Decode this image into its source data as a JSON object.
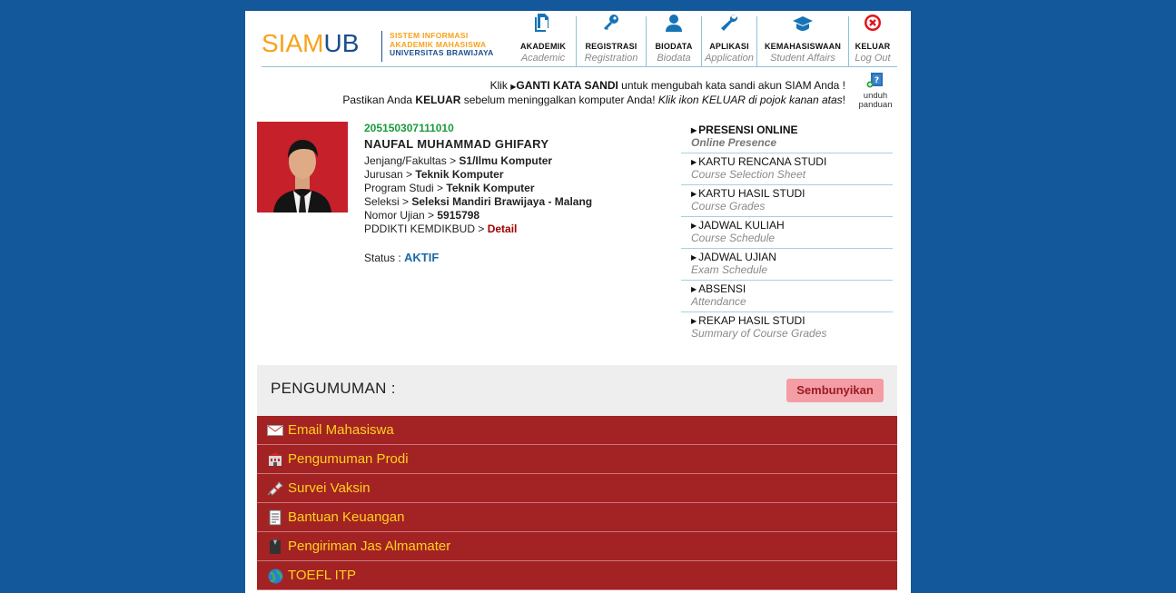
{
  "header": {
    "logo_siam": "SIAM",
    "logo_ub": "UB",
    "tagline": [
      "SISTEM INFORMASI",
      "AKADEMIK MAHASISWA",
      "UNIVERSITAS BRAWIJAYA"
    ]
  },
  "nav": [
    {
      "label": "AKADEMIK",
      "sub": "Academic",
      "icon": "document-icon"
    },
    {
      "label": "REGISTRASI",
      "sub": "Registration",
      "icon": "key-icon"
    },
    {
      "label": "BIODATA",
      "sub": "Biodata",
      "icon": "user-icon"
    },
    {
      "label": "APLIKASI",
      "sub": "Application",
      "icon": "wrench-icon"
    },
    {
      "label": "KEMAHASISWAAN",
      "sub": "Student Affairs",
      "icon": "graduation-cap-icon"
    },
    {
      "label": "KELUAR",
      "sub": "Log Out",
      "icon": "close-circle-icon"
    }
  ],
  "notice": {
    "line1_pre": "Klik ",
    "line1_link": "GANTI KATA SANDI",
    "line1_post": " untuk mengubah kata sandi akun SIAM Anda !",
    "line2_pre": "Pastikan Anda ",
    "line2_bold": "KELUAR",
    "line2_mid": " sebelum meninggalkan komputer Anda! ",
    "line2_italic": "Klik ikon KELUAR di pojok kanan atas",
    "line2_end": "!"
  },
  "help": {
    "line1": "unduh",
    "line2": "panduan"
  },
  "profile": {
    "nim": "205150307111010",
    "name": "NAUFAL MUHAMMAD GHIFARY",
    "rows": [
      {
        "label": "Jenjang/Fakultas",
        "value": "S1/Ilmu Komputer"
      },
      {
        "label": "Jurusan",
        "value": "Teknik Komputer"
      },
      {
        "label": "Program Studi",
        "value": "Teknik Komputer"
      },
      {
        "label": "Seleksi",
        "value": "Seleksi Mandiri Brawijaya - Malang"
      },
      {
        "label": "Nomor Ujian",
        "value": "5915798"
      }
    ],
    "pddikti_label": "PDDIKTI KEMDIKBUD",
    "pddikti_link": "Detail",
    "status_label": "Status : ",
    "status_value": "AKTIF"
  },
  "menu": [
    {
      "label": "PRESENSI ONLINE",
      "sub": "Online Presence"
    },
    {
      "label": "KARTU RENCANA STUDI",
      "sub": "Course Selection Sheet"
    },
    {
      "label": "KARTU HASIL STUDI",
      "sub": "Course Grades"
    },
    {
      "label": "JADWAL KULIAH",
      "sub": "Course Schedule"
    },
    {
      "label": "JADWAL UJIAN",
      "sub": "Exam Schedule"
    },
    {
      "label": "ABSENSI",
      "sub": "Attendance"
    },
    {
      "label": "REKAP HASIL STUDI",
      "sub": "Summary of Course Grades"
    }
  ],
  "announcements": {
    "title": "PENGUMUMAN :",
    "hide_label": "Sembunyikan",
    "items": [
      {
        "label": "Email Mahasiswa",
        "icon": "envelope-icon"
      },
      {
        "label": "Pengumuman Prodi",
        "icon": "building-icon"
      },
      {
        "label": "Survei Vaksin",
        "icon": "syringe-icon"
      },
      {
        "label": "Bantuan Keuangan",
        "icon": "document-icon"
      },
      {
        "label": "Pengiriman Jas Almamater",
        "icon": "suit-icon"
      },
      {
        "label": "TOEFL ITP",
        "icon": "globe-icon"
      }
    ]
  },
  "colors": {
    "background": "#14589c",
    "logo_orange": "#f7a21b",
    "logo_blue": "#1a4f8f",
    "nim_green": "#1a9a3c",
    "status_blue": "#1a6aa6",
    "announcement_red": "#a32224",
    "announcement_text": "#ffd21a",
    "hide_button": "#f49da4"
  }
}
